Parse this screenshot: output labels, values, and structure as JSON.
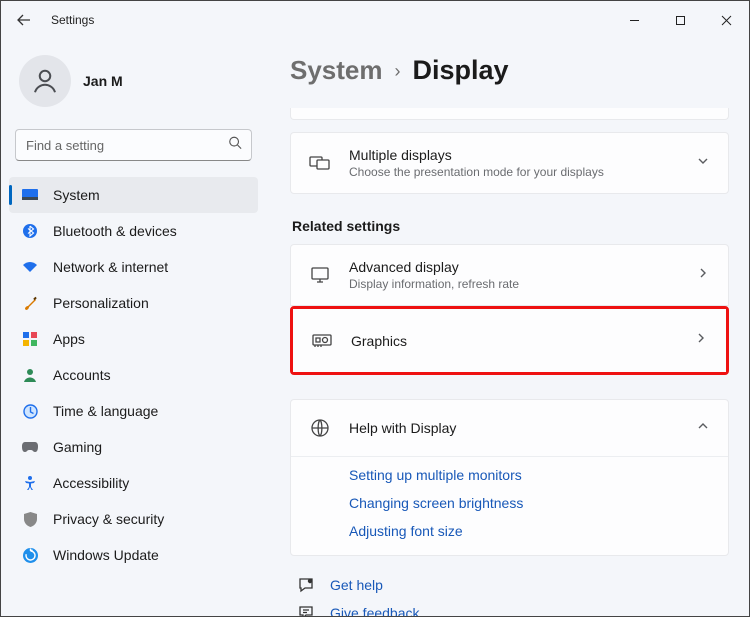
{
  "app": {
    "title": "Settings"
  },
  "profile": {
    "name": "Jan M"
  },
  "search": {
    "placeholder": "Find a setting"
  },
  "nav": {
    "items": [
      {
        "label": "System"
      },
      {
        "label": "Bluetooth & devices"
      },
      {
        "label": "Network & internet"
      },
      {
        "label": "Personalization"
      },
      {
        "label": "Apps"
      },
      {
        "label": "Accounts"
      },
      {
        "label": "Time & language"
      },
      {
        "label": "Gaming"
      },
      {
        "label": "Accessibility"
      },
      {
        "label": "Privacy & security"
      },
      {
        "label": "Windows Update"
      }
    ]
  },
  "breadcrumb": {
    "parent": "System",
    "current": "Display"
  },
  "multi_displays": {
    "title": "Multiple displays",
    "sub": "Choose the presentation mode for your displays"
  },
  "related_label": "Related settings",
  "advanced": {
    "title": "Advanced display",
    "sub": "Display information, refresh rate"
  },
  "graphics": {
    "title": "Graphics"
  },
  "help": {
    "title": "Help with Display",
    "links": [
      "Setting up multiple monitors",
      "Changing screen brightness",
      "Adjusting font size"
    ]
  },
  "footer": {
    "get_help": "Get help",
    "feedback": "Give feedback"
  }
}
